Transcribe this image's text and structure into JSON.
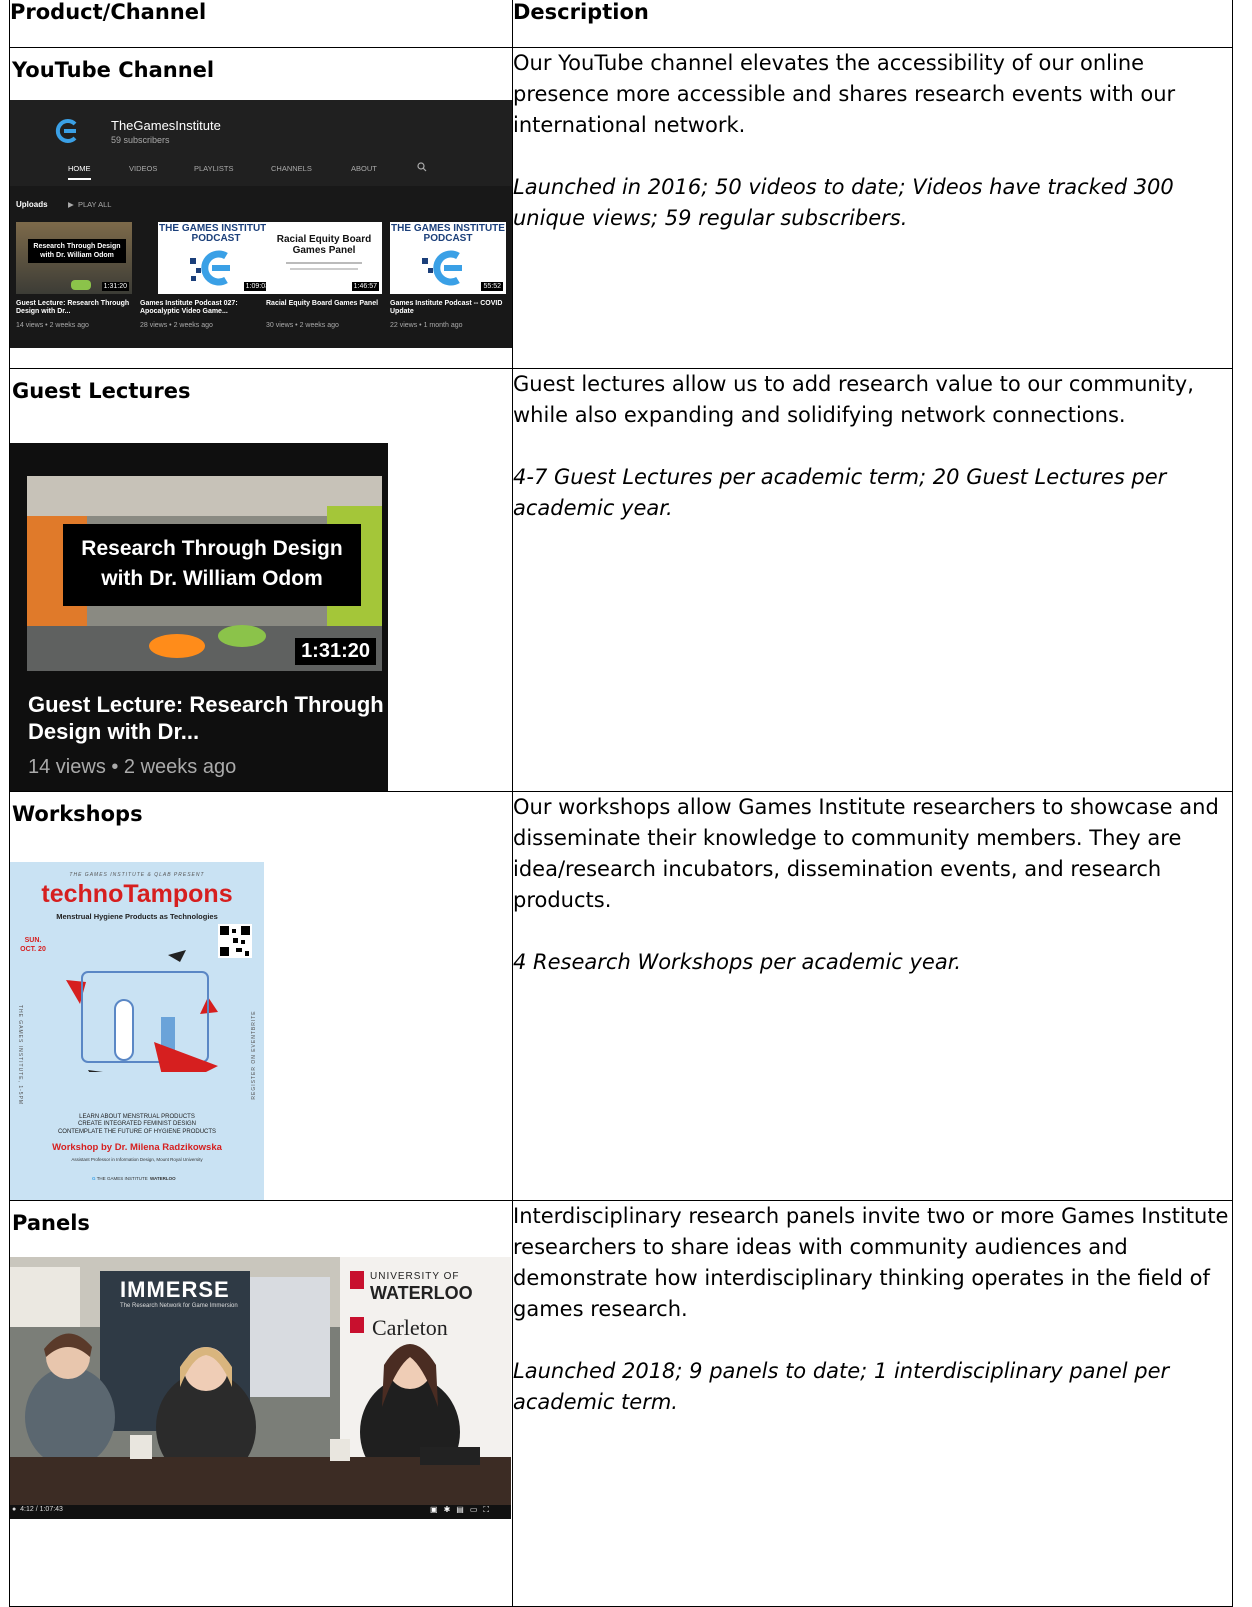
{
  "header": {
    "col1": "Product/Channel",
    "col2": "Description"
  },
  "rows": [
    {
      "label": "YouTube Channel",
      "desc": "Our YouTube channel elevates the accessibility of our online presence more accessible and shares research events with our international network.",
      "stats": "Launched in 2016; 50 videos to date; Videos have tracked 300 unique views; 59 regular subscribers."
    },
    {
      "label": "Guest Lectures",
      "desc": "Guest lectures allow us to add research value to our community, while also expanding and solidifying network connections.",
      "stats": "4-7 Guest Lectures per academic term; 20 Guest Lectures per academic year."
    },
    {
      "label": "Workshops",
      "desc": "Our workshops allow Games Institute researchers to showcase and disseminate their knowledge to community members. They are idea/research incubators, dissemination events, and research products.",
      "stats": "4 Research Workshops per academic year."
    },
    {
      "label": "Panels",
      "desc": "Interdisciplinary research panels invite two or more Games Institute researchers to share ideas with community audiences and demonstrate how interdisciplinary thinking operates in the field of games research.",
      "stats": "Launched 2018; 9 panels to date; 1 interdisciplinary panel per academic term."
    }
  ],
  "youtube": {
    "channel_name": "TheGamesInstitute",
    "subscribers": "59 subscribers",
    "tabs": [
      "HOME",
      "VIDEOS",
      "PLAYLISTS",
      "CHANNELS",
      "ABOUT"
    ],
    "uploads_label": "Uploads",
    "play_all": "PLAY ALL",
    "videos": [
      {
        "thumb_text": "Research Through Design with Dr. William Odom",
        "duration": "1:31:20",
        "title": "Guest Lecture: Research Through Design with Dr...",
        "meta": "14 views • 2 weeks ago"
      },
      {
        "thumb_text": "THE GAMES INSTITUTE PODCAST",
        "duration": "1:09:03",
        "title": "Games Institute Podcast 027: Apocalyptic Video Game...",
        "meta": "28 views • 2 weeks ago"
      },
      {
        "thumb_text": "Racial Equity Board Games Panel",
        "duration": "1:46:57",
        "title": "Racial Equity Board Games Panel",
        "meta": "30 views • 2 weeks ago"
      },
      {
        "thumb_text": "THE GAMES INSTITUTE PODCAST",
        "duration": "55:52",
        "title": "Games Institute Podcast -- COVID Update",
        "meta": "22 views • 1 month ago"
      }
    ]
  },
  "guest_card": {
    "overlay": "Research Through Design with Dr. William Odom",
    "duration": "1:31:20",
    "title": "Guest Lecture: Research Through Design with Dr...",
    "meta": "14 views • 2 weeks ago"
  },
  "poster": {
    "presenter": "THE GAMES INSTITUTE & QLAB PRESENT",
    "title": "technoTampons",
    "subtitle": "Menstrual Hygiene Products as Technologies",
    "date": "SUN. OCT. 20",
    "side_left": "THE GAMES INSTITUTE, 1-5PM",
    "side_right": "REGISTER ON EVENTBRITE",
    "line1": "LEARN ABOUT MENSTRUAL PRODUCTS",
    "line2": "CREATE INTEGRATED FEMINIST DESIGN",
    "line3": "CONTEMPLATE THE FUTURE OF HYGIENE PRODUCTS",
    "workshop_by": "Workshop by Dr. Milena Radzikowska",
    "affiliation": "Assistant Professor in Information Design, Mount Royal University",
    "logo1": "THE GAMES INSTITUTE",
    "logo2": "WATERLOO"
  },
  "panel_photo": {
    "banner": "IMMERSE",
    "banner_sub": "The Research Network for Game Immersion",
    "uni": "UNIVERSITY OF",
    "waterloo": "WATERLOO",
    "carleton": "Carleton",
    "time": "4:12 / 1:07:43"
  }
}
